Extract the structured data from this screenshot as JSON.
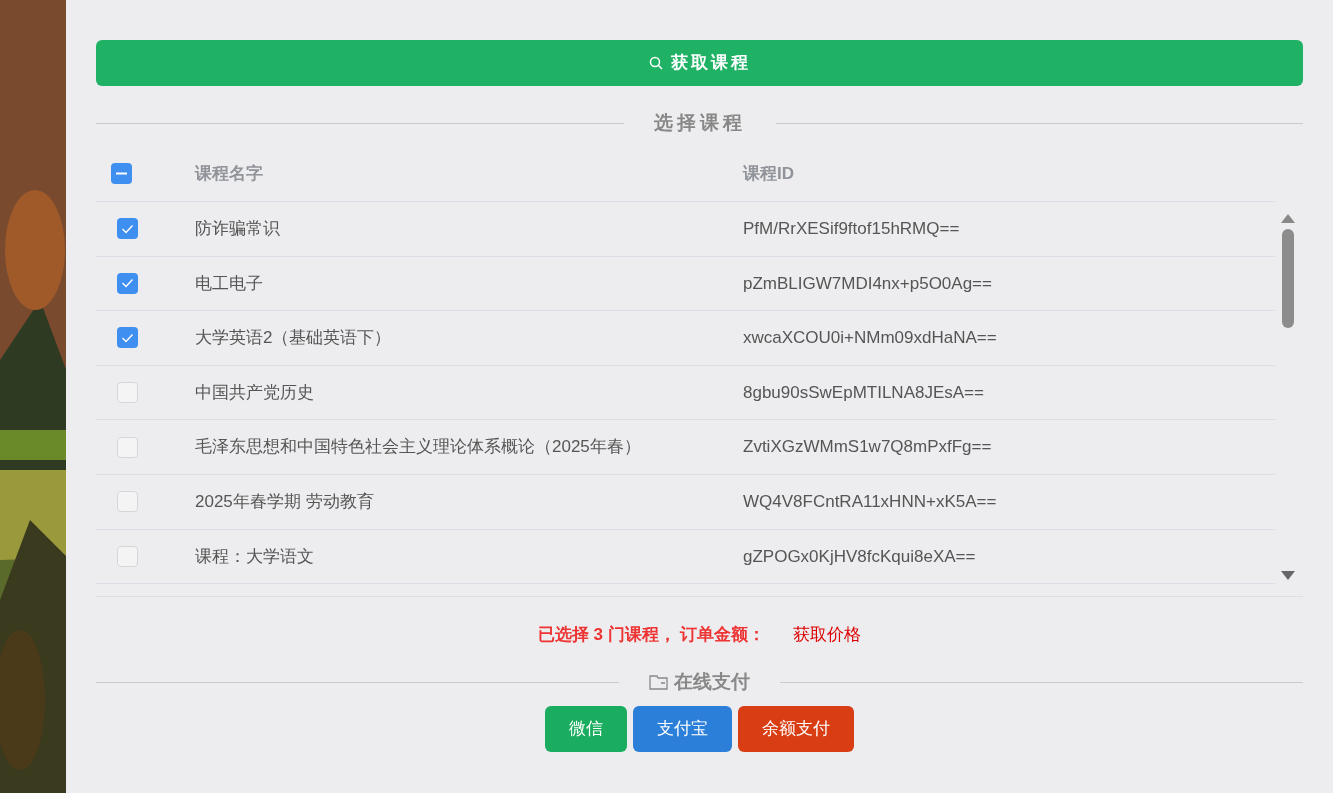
{
  "fetch_button": {
    "label": "获取课程"
  },
  "course_section": {
    "title": "选择课程"
  },
  "table": {
    "select_all": {
      "indeterminate": true
    },
    "columns": [
      "课程名字",
      "课程ID"
    ],
    "rows": [
      {
        "name": "防诈骗常识",
        "id": "PfM/RrXESif9ftof15hRMQ==",
        "checked": true
      },
      {
        "name": "电工电子",
        "id": "pZmBLIGW7MDI4nx+p5O0Ag==",
        "checked": true
      },
      {
        "name": "大学英语2（基础英语下）",
        "id": "xwcaXCOU0i+NMm09xdHaNA==",
        "checked": true
      },
      {
        "name": "中国共产党历史",
        "id": "8gbu90sSwEpMTILNA8JEsA==",
        "checked": false
      },
      {
        "name": "毛泽东思想和中国特色社会主义理论体系概论（2025年春）",
        "id": "ZvtiXGzWMmS1w7Q8mPxfFg==",
        "checked": false
      },
      {
        "name": "2025年春学期 劳动教育",
        "id": "WQ4V8FCntRA11xHNN+xK5A==",
        "checked": false
      },
      {
        "name": "课程：大学语文",
        "id": "gZPOGx0KjHV8fcKqui8eXA==",
        "checked": false
      }
    ]
  },
  "summary": {
    "text": "已选择 3 门课程， 订单金额：",
    "price_link": "获取价格"
  },
  "payment_section": {
    "title": "在线支付"
  },
  "payment_buttons": [
    {
      "label": "微信",
      "kind": "wechat"
    },
    {
      "label": "支付宝",
      "kind": "alipay"
    },
    {
      "label": "余额支付",
      "kind": "balance"
    }
  ]
}
